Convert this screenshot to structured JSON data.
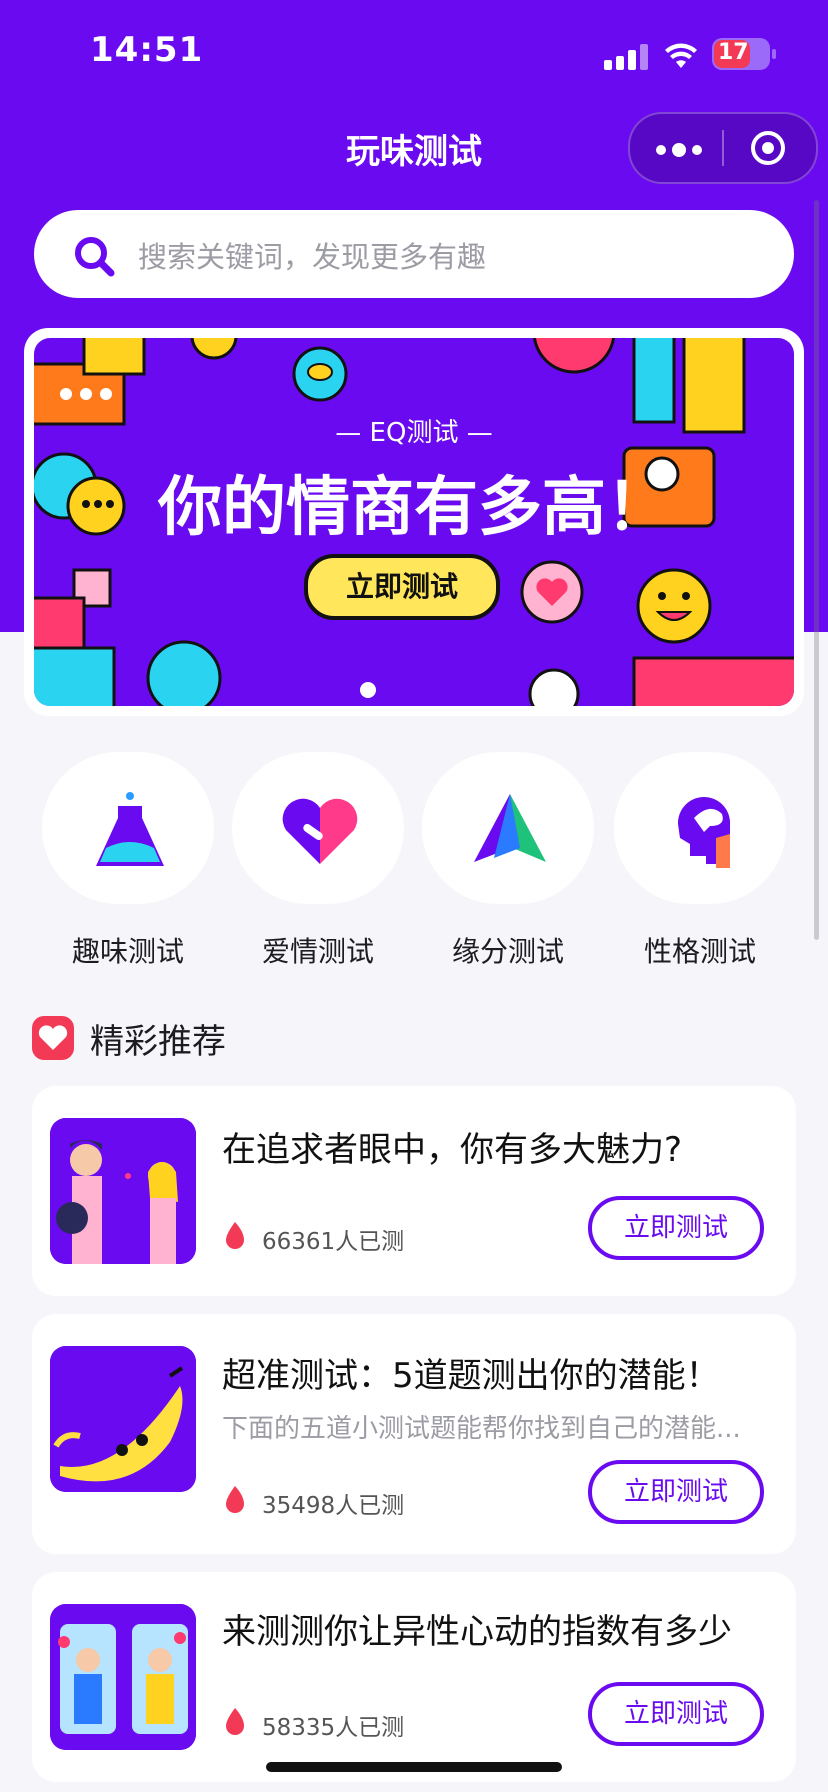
{
  "status_bar": {
    "time": "14:51",
    "battery": "17"
  },
  "nav": {
    "title": "玩味测试"
  },
  "search": {
    "placeholder": "搜索关键词，发现更多有趣"
  },
  "banner": {
    "tag": "— EQ测试 —",
    "headline": "你的情商有多高！",
    "button": "立即测试"
  },
  "categories": [
    {
      "label": "趣味测试",
      "icon": "flask-icon"
    },
    {
      "label": "爱情测试",
      "icon": "heart-icon"
    },
    {
      "label": "缘分测试",
      "icon": "triangle-icon"
    },
    {
      "label": "性格测试",
      "icon": "head-icon"
    }
  ],
  "section": {
    "title": "精彩推荐"
  },
  "cards": [
    {
      "title": "在追求者眼中，你有多大魅力?",
      "desc": "",
      "count": "66361人已测",
      "button": "立即测试"
    },
    {
      "title": "超准测试：5道题测出你的潜能！",
      "desc": "下面的五道小测试题能帮你找到自己的潜能...",
      "count": "35498人已测",
      "button": "立即测试"
    },
    {
      "title": "来测测你让异性心动的指数有多少",
      "desc": "",
      "count": "58335人已测",
      "button": "立即测试"
    }
  ],
  "colors": {
    "primary": "#6a0af0",
    "accent": "#f23a57",
    "banner_button": "#ffe65a"
  }
}
